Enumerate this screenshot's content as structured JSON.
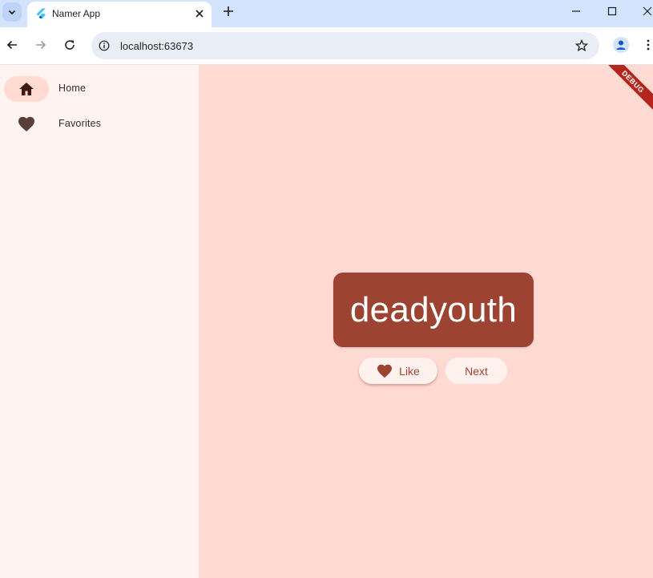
{
  "browser": {
    "tab_title": "Namer App",
    "url": "localhost:63673"
  },
  "app": {
    "nav": [
      {
        "label": "Home",
        "icon": "home-icon",
        "selected": true
      },
      {
        "label": "Favorites",
        "icon": "favorite-icon",
        "selected": false
      }
    ],
    "word": "deadyouth",
    "like_label": "Like",
    "next_label": "Next",
    "debug_banner": "DEBUG"
  },
  "colors": {
    "primary": "#9c4431",
    "background": "#ffdad2",
    "rail": "#fff4f2",
    "rail_indicator": "#ffdbd1",
    "button": "#fff1ee"
  }
}
